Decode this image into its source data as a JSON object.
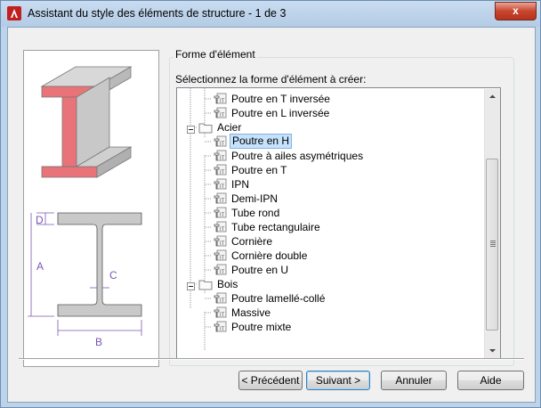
{
  "window": {
    "title": "Assistant du style des éléments de structure - 1 de 3",
    "close_label": "x"
  },
  "group": {
    "label": "Forme d'élément",
    "select_label": "Sélectionnez la forme d'élément à créer:"
  },
  "preview": {
    "labels": {
      "d": "D",
      "a": "A",
      "c": "C",
      "b": "B"
    }
  },
  "tree": {
    "items": [
      {
        "label": "Poutre en T inversée",
        "kind": "shape",
        "level": 2
      },
      {
        "label": "Poutre en L inversée",
        "kind": "shape",
        "level": 2
      },
      {
        "label": "Acier",
        "kind": "folder",
        "level": 1,
        "expanded": true
      },
      {
        "label": "Poutre en H",
        "kind": "shape",
        "level": 2,
        "selected": true
      },
      {
        "label": "Poutre à ailes asymétriques",
        "kind": "shape",
        "level": 2
      },
      {
        "label": "Poutre en T",
        "kind": "shape",
        "level": 2
      },
      {
        "label": "IPN",
        "kind": "shape",
        "level": 2
      },
      {
        "label": "Demi-IPN",
        "kind": "shape",
        "level": 2
      },
      {
        "label": "Tube rond",
        "kind": "shape",
        "level": 2
      },
      {
        "label": "Tube rectangulaire",
        "kind": "shape",
        "level": 2
      },
      {
        "label": "Cornière",
        "kind": "shape",
        "level": 2
      },
      {
        "label": "Cornière double",
        "kind": "shape",
        "level": 2
      },
      {
        "label": "Poutre en U",
        "kind": "shape",
        "level": 2
      },
      {
        "label": "Bois",
        "kind": "folder",
        "level": 1,
        "expanded": true
      },
      {
        "label": "Poutre lamellé-collé",
        "kind": "shape",
        "level": 2
      },
      {
        "label": "Massive",
        "kind": "shape",
        "level": 2
      },
      {
        "label": "Poutre mixte",
        "kind": "shape",
        "level": 2
      }
    ]
  },
  "buttons": {
    "previous": "< Précédent",
    "next": "Suivant >",
    "cancel": "Annuler",
    "help": "Aide"
  },
  "colors": {
    "title_bg": "#bcd3ea",
    "selection": "#c6e2fb",
    "beam_red": "#e8747a"
  }
}
